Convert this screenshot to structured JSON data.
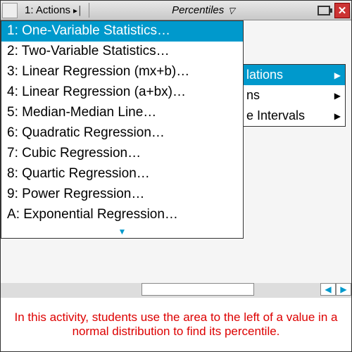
{
  "toolbar": {
    "actions_label": "1: Actions",
    "title": "Percentiles"
  },
  "menu": {
    "items": [
      {
        "key": "1",
        "label": "One-Variable Statistics…",
        "selected": true
      },
      {
        "key": "2",
        "label": "Two-Variable Statistics…"
      },
      {
        "key": "3",
        "label": "Linear Regression (mx+b)…"
      },
      {
        "key": "4",
        "label": "Linear Regression (a+bx)…"
      },
      {
        "key": "5",
        "label": "Median-Median Line…"
      },
      {
        "key": "6",
        "label": "Quadratic Regression…"
      },
      {
        "key": "7",
        "label": "Cubic Regression…"
      },
      {
        "key": "8",
        "label": "Quartic Regression…"
      },
      {
        "key": "9",
        "label": "Power Regression…"
      },
      {
        "key": "A",
        "label": "Exponential Regression…"
      }
    ]
  },
  "side_menu": {
    "items": [
      {
        "label": "lations",
        "selected": true
      },
      {
        "label": "ns"
      },
      {
        "label": "e Intervals"
      }
    ]
  },
  "caption": "In this activity, students use the area to the left of a value in a normal distribution to find its percentile."
}
